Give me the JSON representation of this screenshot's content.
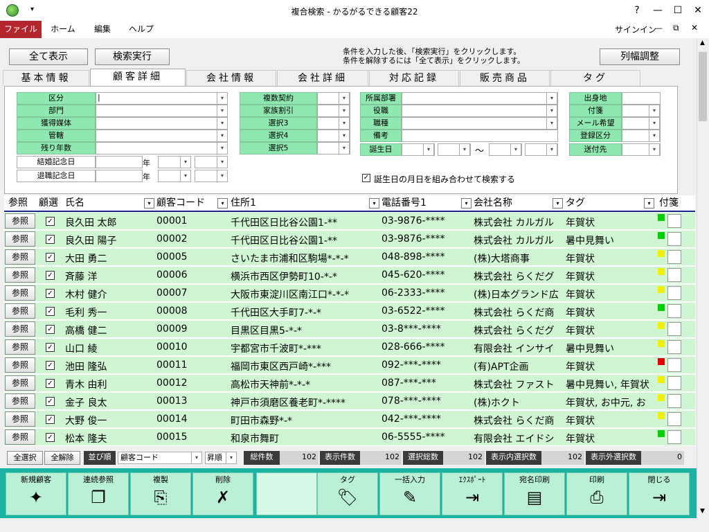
{
  "window": {
    "title": "複合検索 - かるがるできる顧客22",
    "help": "?",
    "minimize": "—",
    "maximize": "☐",
    "close": "✕"
  },
  "menu": {
    "file": "ファイル",
    "home": "ホーム",
    "edit": "編集",
    "help": "ヘルプ",
    "signin": "サインイン",
    "r_min": "—",
    "r_restore": "⧉",
    "r_close": "✕"
  },
  "toolbar_top": {
    "show_all": "全て表示",
    "search": "検索実行",
    "note1": "条件を入力した後、「検索実行」をクリックします。",
    "note2": "条件を解除するには「全て表示」をクリックします。",
    "col_adjust": "列幅調整"
  },
  "tabs": [
    "基本情報",
    "顧客詳細",
    "会社情報",
    "会社詳細",
    "対応記録",
    "販売商品",
    "タグ"
  ],
  "filter": {
    "col1": [
      "区分",
      "部門",
      "獲得媒体",
      "管轄",
      "残り年数"
    ],
    "col1b": [
      "結婚記念日",
      "退職記念日"
    ],
    "year": "年",
    "col1_input0": "|",
    "col2": [
      "複数契約",
      "家族割引",
      "選択3",
      "選択4",
      "選択5"
    ],
    "col3": [
      "所属部署",
      "役職",
      "職種",
      "備考",
      "誕生日"
    ],
    "tilde": "〜",
    "col4": [
      "出身地",
      "付箋",
      "メール希望",
      "登録区分",
      "送付先"
    ],
    "birthday_check": "誕生日の月日を組み合わせて検索する"
  },
  "grid": {
    "headers": {
      "ref": "参照",
      "select": "顧選",
      "name": "氏名",
      "code": "顧客コード",
      "address": "住所1",
      "phone": "電話番号1",
      "company": "会社名称",
      "tag": "タグ",
      "sticky": "付箋"
    },
    "ref_label": "参照",
    "rows": [
      {
        "name": "良久田 太郎",
        "code": "00001",
        "address": "千代田区日比谷公園1-**",
        "phone": "03-9876-****",
        "company": "株式会社 カルガル",
        "tag": "年賀状",
        "color": "#00d000"
      },
      {
        "name": "良久田 陽子",
        "code": "00002",
        "address": "千代田区日比谷公園1-**",
        "phone": "03-9876-****",
        "company": "株式会社 カルガル",
        "tag": "暑中見舞い",
        "color": "#00d000"
      },
      {
        "name": "大田 勇二",
        "code": "00005",
        "address": "さいたま市浦和区駒場*-*-*",
        "phone": "048-898-****",
        "company": "(株)大塔商事",
        "tag": "年賀状",
        "color": "#f0f000"
      },
      {
        "name": "斉藤 洋",
        "code": "00006",
        "address": "横浜市西区伊勢町10-*-*",
        "phone": "045-620-****",
        "company": "株式会社 らくだグ",
        "tag": "年賀状",
        "color": "#f0f000"
      },
      {
        "name": "木村 健介",
        "code": "00007",
        "address": "大阪市東淀川区南江口*-*-*",
        "phone": "06-2333-****",
        "company": "(株)日本グランド広",
        "tag": "年賀状",
        "color": "#f0f000"
      },
      {
        "name": "毛利 秀一",
        "code": "00008",
        "address": "千代田区大手町7-*-*",
        "phone": "03-6522-****",
        "company": "株式会社 らくだ商",
        "tag": "年賀状",
        "color": "#00d000"
      },
      {
        "name": "高橋 健二",
        "code": "00009",
        "address": "目黒区目黒5-*-*",
        "phone": "03-8***-****",
        "company": "株式会社 らくだグ",
        "tag": "年賀状",
        "color": "#f0f000"
      },
      {
        "name": "山口 綾",
        "code": "00010",
        "address": "宇都宮市千波町*-***",
        "phone": "028-666-****",
        "company": "有限会社 インサイ",
        "tag": "暑中見舞い",
        "color": "#f0f000"
      },
      {
        "name": "池田 隆弘",
        "code": "00011",
        "address": "福岡市東区西戸崎*-***",
        "phone": "092-***-****",
        "company": "(有)APT企画",
        "tag": "年賀状",
        "color": "#e00000"
      },
      {
        "name": "青木 由利",
        "code": "00012",
        "address": "高松市天神前*-*-*",
        "phone": "087-***-***",
        "company": "株式会社 ファスト",
        "tag": "暑中見舞い, 年賀状",
        "color": "#f0f000"
      },
      {
        "name": "金子 良太",
        "code": "00013",
        "address": "神戸市須磨区養老町*-****",
        "phone": "078-***-****",
        "company": "(株)ホクト",
        "tag": "年賀状, お中元, お",
        "color": "#f0f000"
      },
      {
        "name": "大野 俊一",
        "code": "00014",
        "address": "町田市森野*-*",
        "phone": "042-***-****",
        "company": "株式会社 らくだ商",
        "tag": "年賀状",
        "color": "#f0f000"
      },
      {
        "name": "松本 隆夫",
        "code": "00015",
        "address": "和泉市舞町",
        "phone": "06-5555-****",
        "company": "有限会社 エイドシ",
        "tag": "年賀状",
        "color": "#00d000"
      }
    ]
  },
  "status": {
    "select_all": "全選択",
    "clear_all": "全解除",
    "sort_label": "並び順",
    "sort_value": "顧客コード",
    "order": "昇順",
    "total_label": "総件数",
    "total": "102",
    "shown_label": "表示件数",
    "shown": "102",
    "selected_label": "選択総数",
    "selected": "102",
    "in_sel_label": "表示内選択数",
    "in_sel": "102",
    "out_sel_label": "表示外選択数",
    "out_sel": "0"
  },
  "bottom_buttons": [
    {
      "label": "新規顧客",
      "icon": "new-customer-icon",
      "glyph": "✦"
    },
    {
      "label": "連続参照",
      "icon": "continuous-view-icon",
      "glyph": "❐"
    },
    {
      "label": "複製",
      "icon": "duplicate-icon",
      "glyph": "⎘"
    },
    {
      "label": "削除",
      "icon": "delete-icon",
      "glyph": "✗"
    },
    {
      "label": "",
      "icon": "",
      "glyph": ""
    },
    {
      "label": "タグ",
      "icon": "tag-icon",
      "glyph": "🏷"
    },
    {
      "label": "一括入力",
      "icon": "bulk-input-icon",
      "glyph": "✎"
    },
    {
      "label": "ｴｸｽﾎﾟｰﾄ",
      "icon": "export-icon",
      "glyph": "⇥"
    },
    {
      "label": "宛名印刷",
      "icon": "address-print-icon",
      "glyph": "▤"
    },
    {
      "label": "印刷",
      "icon": "print-icon",
      "glyph": "⎙"
    },
    {
      "label": "閉じる",
      "icon": "close-door-icon",
      "glyph": "⇥"
    }
  ],
  "colors": {
    "accent": "#b3262e",
    "toolbar": "#1bb3a3",
    "row": "#cff5d2",
    "label": "#8fe8b0"
  }
}
